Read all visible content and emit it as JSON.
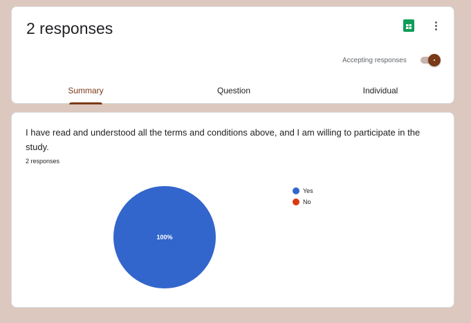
{
  "header": {
    "title": "2 responses",
    "accepting_label": "Accepting responses",
    "accepting": true,
    "sheets_icon": "google-sheets-icon",
    "more_icon": "more-vert-icon"
  },
  "tabs": [
    {
      "label": "Summary",
      "active": true
    },
    {
      "label": "Question",
      "active": false
    },
    {
      "label": "Individual",
      "active": false
    }
  ],
  "question": {
    "text": "I have read and understood all the terms and conditions above, and I am willing to participate in the study.",
    "responses": "2 responses"
  },
  "colors": {
    "accent": "#7a3a17",
    "background": "#dcc8bf",
    "yes": "#3366cc",
    "no": "#dc3912",
    "sheets_green": "#0f9d58"
  },
  "chart_data": {
    "type": "pie",
    "categories": [
      "Yes",
      "No"
    ],
    "values": [
      100,
      0
    ],
    "slice_labels": [
      "100%",
      ""
    ],
    "colors": [
      "#3366cc",
      "#dc3912"
    ],
    "legend_position": "right"
  }
}
